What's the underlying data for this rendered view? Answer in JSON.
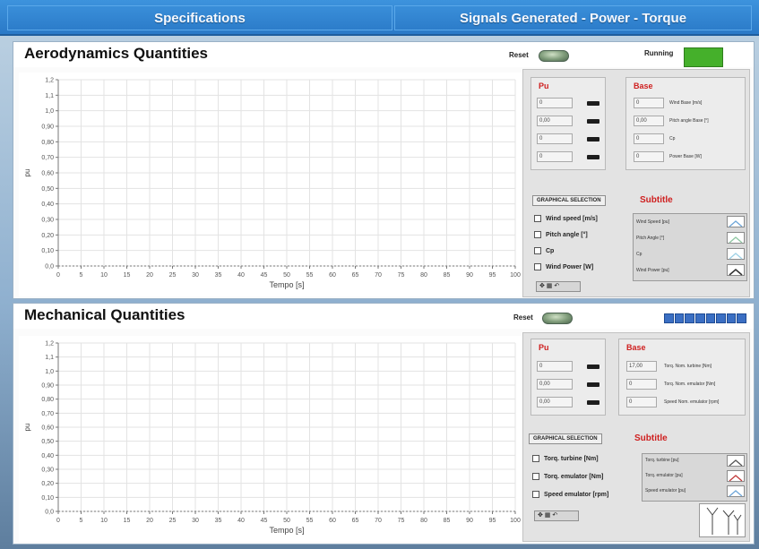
{
  "tabs": [
    "Specifications",
    "Signals Generated - Power - Torque"
  ],
  "aero": {
    "title": "Aerodynamics Quantities",
    "reset_label": "Reset",
    "running_label": "Running",
    "running_color": "#45b02b",
    "chart_data": {
      "type": "line",
      "title": "",
      "xlabel": "Tempo [s]",
      "ylabel": "pu",
      "xlim": [
        0,
        100
      ],
      "ylim": [
        0,
        1.2
      ],
      "xticks": [
        "0",
        "5",
        "10",
        "15",
        "20",
        "25",
        "30",
        "35",
        "40",
        "45",
        "50",
        "55",
        "60",
        "65",
        "70",
        "75",
        "80",
        "85",
        "90",
        "95",
        "100"
      ],
      "yticks": [
        "0,0",
        "0,10",
        "0,20",
        "0,30",
        "0,40",
        "0,50",
        "0,60",
        "0,70",
        "0,80",
        "0,90",
        "1,0",
        "1,1",
        "1,2"
      ],
      "grid": true,
      "series": []
    },
    "pu": {
      "title": "Pu",
      "values": [
        "0",
        "0,00",
        "0",
        "0"
      ]
    },
    "base": {
      "title": "Base",
      "values": [
        "0",
        "0,00",
        "0",
        "0"
      ],
      "labels": [
        "Wind Base [m/s]",
        "Pitch angle Base [°]",
        "Cp",
        "Power Base [W]"
      ]
    },
    "graphical_selection": "GRAPHICAL SELECTION",
    "subtitle": "Subtitle",
    "checks": [
      "Wind speed [m/s]",
      "Pitch angle [°]",
      "Cp",
      "Wind Power [W]"
    ],
    "legend": [
      "Wind Speed [pu]",
      "Pitch Angle [°]",
      "Cp",
      "Wind Power [pu]"
    ],
    "legend_colors": [
      "#6fa6d8",
      "#8fc7a3",
      "#9fd1e6",
      "#333333"
    ],
    "tools_label": "✥ ▦ ↶"
  },
  "mech": {
    "title": "Mechanical Quantities",
    "reset_label": "Reset",
    "progress_color": "#3b6fc3",
    "chart_data": {
      "type": "line",
      "title": "",
      "xlabel": "Tempo [s]",
      "ylabel": "pu",
      "xlim": [
        0,
        100
      ],
      "ylim": [
        0,
        1.2
      ],
      "xticks": [
        "0",
        "5",
        "10",
        "15",
        "20",
        "25",
        "30",
        "35",
        "40",
        "45",
        "50",
        "55",
        "60",
        "65",
        "70",
        "75",
        "80",
        "85",
        "90",
        "95",
        "100"
      ],
      "yticks": [
        "0,0",
        "0,10",
        "0,20",
        "0,30",
        "0,40",
        "0,50",
        "0,60",
        "0,70",
        "0,80",
        "0,90",
        "1,0",
        "1,1",
        "1,2"
      ],
      "grid": true,
      "series": []
    },
    "pu": {
      "title": "Pu",
      "values": [
        "0",
        "0,00",
        "0,00"
      ]
    },
    "base": {
      "title": "Base",
      "values": [
        "17,00",
        "0",
        "0"
      ],
      "labels": [
        "Torq. Nom. turbine [Nm]",
        "Torq. Nom. emulator [Nm]",
        "Speed Nom. emulator [rpm]"
      ]
    },
    "graphical_selection": "GRAPHICAL SELECTION",
    "subtitle": "Subtitle",
    "checks": [
      "Torq. turbine [Nm]",
      "Torq. emulator [Nm]",
      "Speed emulator [rpm]"
    ],
    "legend": [
      "Torq. turbine [pu]",
      "Torq. emulator [pu]",
      "Speed emulator [pu]"
    ],
    "legend_colors": [
      "#555555",
      "#c23b3b",
      "#6fa6d8"
    ],
    "tools_label": "✥ ▦ ↶"
  }
}
